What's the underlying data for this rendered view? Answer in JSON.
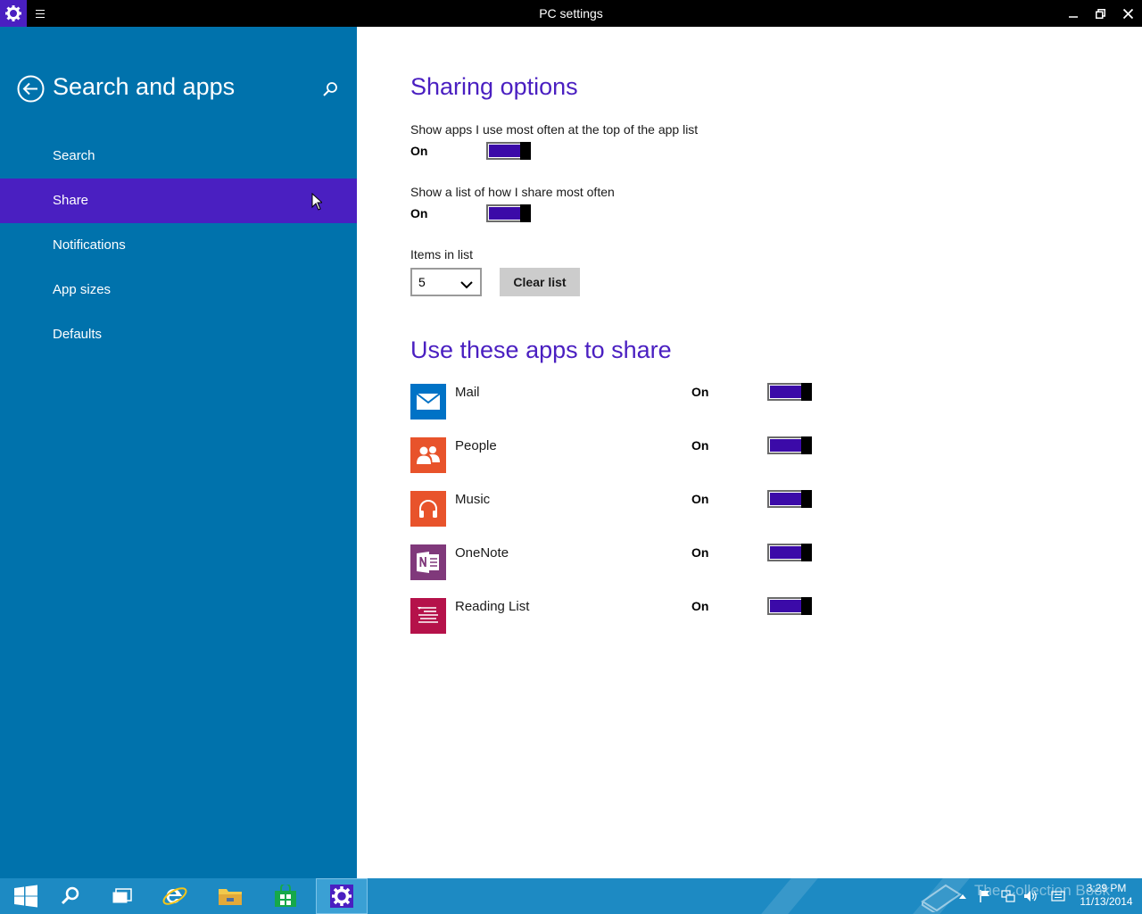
{
  "window": {
    "title": "PC settings"
  },
  "sidebar": {
    "heading": "Search and apps",
    "items": [
      {
        "label": "Search",
        "selected": false
      },
      {
        "label": "Share",
        "selected": true
      },
      {
        "label": "Notifications",
        "selected": false
      },
      {
        "label": "App sizes",
        "selected": false
      },
      {
        "label": "Defaults",
        "selected": false
      }
    ]
  },
  "sharing_options": {
    "title": "Sharing options",
    "show_apps_top": {
      "label": "Show apps I use most often at the top of the app list",
      "state": "On",
      "on": true
    },
    "show_share_list": {
      "label": "Show a list of how I share most often",
      "state": "On",
      "on": true
    },
    "items_in_list": {
      "label": "Items in list",
      "value": "5"
    },
    "clear_list_label": "Clear list"
  },
  "share_apps": {
    "title": "Use these apps to share",
    "apps": [
      {
        "name": "Mail",
        "state": "On",
        "on": true,
        "color": "#0072c6",
        "icon": "mail-icon"
      },
      {
        "name": "People",
        "state": "On",
        "on": true,
        "color": "#e8532b",
        "icon": "people-icon"
      },
      {
        "name": "Music",
        "state": "On",
        "on": true,
        "color": "#e8532b",
        "icon": "headphones-icon"
      },
      {
        "name": "OneNote",
        "state": "On",
        "on": true,
        "color": "#80397b",
        "icon": "onenote-icon"
      },
      {
        "name": "Reading List",
        "state": "On",
        "on": true,
        "color": "#b5124a",
        "icon": "reading-list-icon"
      }
    ]
  },
  "taskbar": {
    "watermark": "The Collection Book",
    "time": "3:29 PM",
    "date": "11/13/2014"
  },
  "colors": {
    "accent": "#4a1fc1",
    "sidebar": "#0072ac",
    "taskbar": "#1d8ac3",
    "toggle_on": "#3b0aa8"
  }
}
